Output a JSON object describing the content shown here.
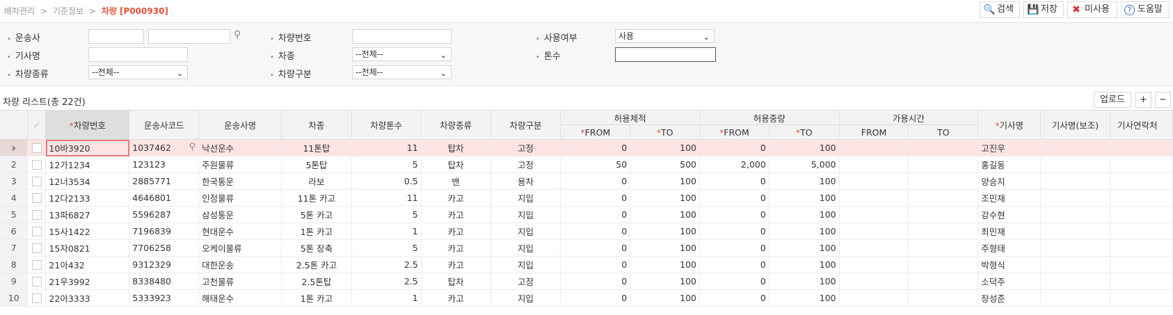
{
  "breadcrumb": {
    "items": [
      "배차관리",
      "기준정보"
    ],
    "separator": ">",
    "current": "차량 [P000930]"
  },
  "toolbar": {
    "search": "검색",
    "save": "저장",
    "unused": "미사용",
    "help": "도움말"
  },
  "filter": {
    "carrier_label": "운송사",
    "vehicle_no_label": "차량번호",
    "use_yn_label": "사용여부",
    "use_yn_value": "사용",
    "driver_label": "기사명",
    "model_label": "차종",
    "model_value": "--전체--",
    "tonnage_label": "톤수",
    "vehicle_type_label": "차량종류",
    "vehicle_type_value": "--전체--",
    "vehicle_class_label": "차량구분",
    "vehicle_class_value": "--전체--"
  },
  "list": {
    "title": "차량 리스트(총 22건)",
    "upload": "업로드",
    "add": "+",
    "remove": "−"
  },
  "columns": {
    "vehicle_no": "차량번호",
    "carrier_code": "운송사코드",
    "carrier_name": "운송사명",
    "model": "차종",
    "tonnage": "차량톤수",
    "type": "차량종류",
    "class": "차량구분",
    "volume": "허용체적",
    "weight": "허용중량",
    "time": "가용시간",
    "from": "FROM",
    "to": "TO",
    "driver": "기사명",
    "driver_sub": "기사명(보조)",
    "driver_contact": "기사연락처"
  },
  "rows": [
    {
      "no": "1",
      "vehicle_no": "10바3920",
      "carrier_code": "1037462",
      "carrier_name": "낙선운수",
      "model": "11톤탑",
      "tonnage": "11",
      "type": "탑차",
      "class": "고정",
      "vol_from": "0",
      "vol_to": "100",
      "wt_from": "0",
      "wt_to": "100",
      "driver": "고진우"
    },
    {
      "no": "2",
      "vehicle_no": "12가1234",
      "carrier_code": "123123",
      "carrier_name": "주원물류",
      "model": "5톤탑",
      "tonnage": "5",
      "type": "탑차",
      "class": "고정",
      "vol_from": "50",
      "vol_to": "500",
      "wt_from": "2,000",
      "wt_to": "5,000",
      "driver": "홍길동"
    },
    {
      "no": "3",
      "vehicle_no": "12너3534",
      "carrier_code": "2885771",
      "carrier_name": "한국통운",
      "model": "라보",
      "tonnage": "0.5",
      "type": "밴",
      "class": "용차",
      "vol_from": "0",
      "vol_to": "100",
      "wt_from": "0",
      "wt_to": "100",
      "driver": "양승지"
    },
    {
      "no": "4",
      "vehicle_no": "12다2133",
      "carrier_code": "4646801",
      "carrier_name": "인정물류",
      "model": "11톤 카고",
      "tonnage": "11",
      "type": "카고",
      "class": "지입",
      "vol_from": "0",
      "vol_to": "100",
      "wt_from": "0",
      "wt_to": "100",
      "driver": "조민재"
    },
    {
      "no": "5",
      "vehicle_no": "13파6827",
      "carrier_code": "5596287",
      "carrier_name": "삼성통운",
      "model": "5톤 카고",
      "tonnage": "5",
      "type": "카고",
      "class": "지입",
      "vol_from": "0",
      "vol_to": "100",
      "wt_from": "0",
      "wt_to": "100",
      "driver": "강수현"
    },
    {
      "no": "6",
      "vehicle_no": "15사1422",
      "carrier_code": "7196839",
      "carrier_name": "현대운수",
      "model": "1톤 카고",
      "tonnage": "1",
      "type": "카고",
      "class": "지입",
      "vol_from": "0",
      "vol_to": "100",
      "wt_from": "0",
      "wt_to": "100",
      "driver": "최민재"
    },
    {
      "no": "7",
      "vehicle_no": "15자0821",
      "carrier_code": "7706258",
      "carrier_name": "오케이물류",
      "model": "5톤 장축",
      "tonnage": "5",
      "type": "카고",
      "class": "지입",
      "vol_from": "0",
      "vol_to": "100",
      "wt_from": "0",
      "wt_to": "100",
      "driver": "주형태"
    },
    {
      "no": "8",
      "vehicle_no": "21아432",
      "carrier_code": "9312329",
      "carrier_name": "대한운송",
      "model": "2.5톤 카고",
      "tonnage": "2.5",
      "type": "카고",
      "class": "지입",
      "vol_from": "0",
      "vol_to": "100",
      "wt_from": "0",
      "wt_to": "100",
      "driver": "박형식"
    },
    {
      "no": "9",
      "vehicle_no": "21우3992",
      "carrier_code": "8338480",
      "carrier_name": "고천물류",
      "model": "2.5톤탑",
      "tonnage": "2.5",
      "type": "탑차",
      "class": "고정",
      "vol_from": "0",
      "vol_to": "100",
      "wt_from": "0",
      "wt_to": "100",
      "driver": "소덕주"
    },
    {
      "no": "10",
      "vehicle_no": "22아3333",
      "carrier_code": "5333923",
      "carrier_name": "해태운수",
      "model": "1톤 카고",
      "tonnage": "1",
      "type": "카고",
      "class": "지입",
      "vol_from": "0",
      "vol_to": "100",
      "wt_from": "0",
      "wt_to": "100",
      "driver": "장성준"
    }
  ]
}
